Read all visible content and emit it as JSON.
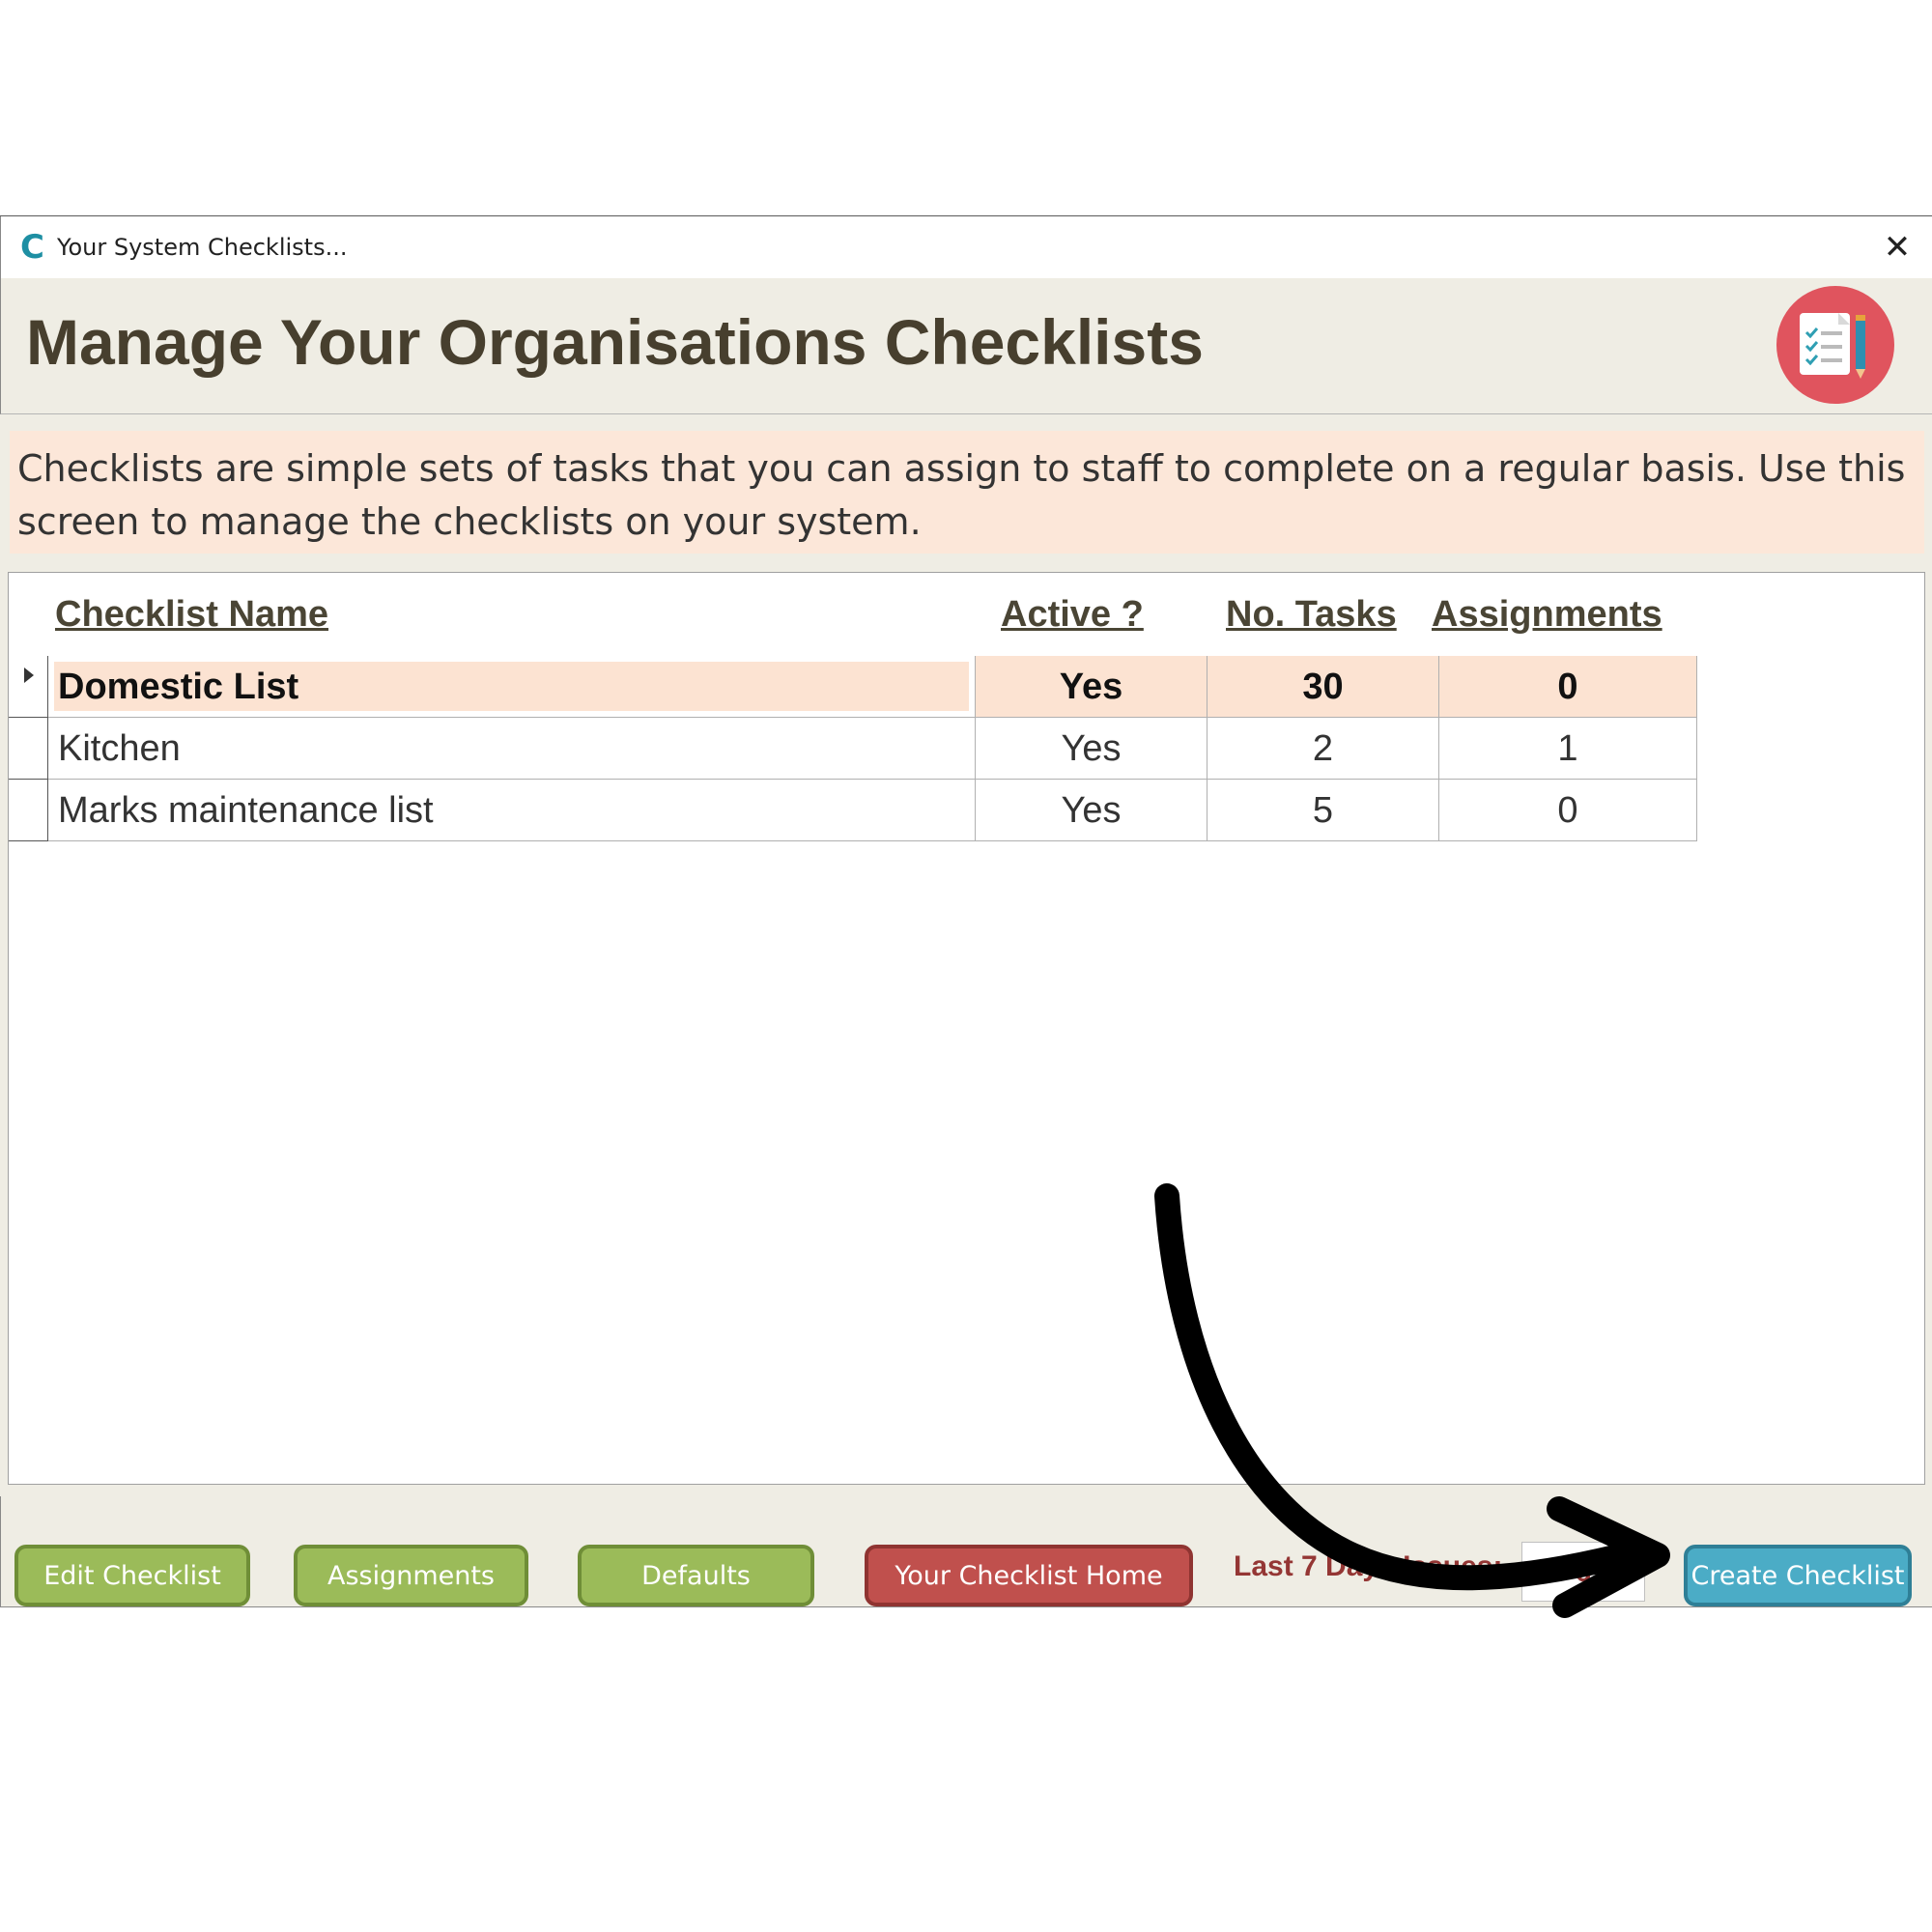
{
  "window": {
    "title": "Your System Checklists...",
    "close_glyph": "✕"
  },
  "header": {
    "title": "Manage Your Organisations Checklists",
    "icon": "checklist-icon"
  },
  "info": {
    "text": "Checklists are simple sets of tasks that you can assign to staff to complete on a regular basis.  Use this screen to manage the checklists on your system."
  },
  "table": {
    "columns": [
      "Checklist Name",
      "Active ?",
      "No. Tasks",
      "Assignments"
    ],
    "rows": [
      {
        "name": "Domestic List",
        "active": "Yes",
        "tasks": "30",
        "assignments": "0",
        "selected": true
      },
      {
        "name": "Kitchen",
        "active": "Yes",
        "tasks": "2",
        "assignments": "1",
        "selected": false
      },
      {
        "name": "Marks maintenance list",
        "active": "Yes",
        "tasks": "5",
        "assignments": "0",
        "selected": false
      }
    ]
  },
  "footer": {
    "edit_label": "Edit Checklist",
    "assignments_label": "Assignments",
    "defaults_label": "Defaults",
    "home_label": "Your Checklist Home",
    "issues_label": "Last 7 Days Issues:",
    "issues_value": "6",
    "create_label": "Create Checklist"
  },
  "colors": {
    "green_button": "#9bbb59",
    "red_button": "#c0504d",
    "blue_button": "#4bacc6",
    "selected_row": "#fce3d2",
    "info_box": "#fce7d9"
  }
}
